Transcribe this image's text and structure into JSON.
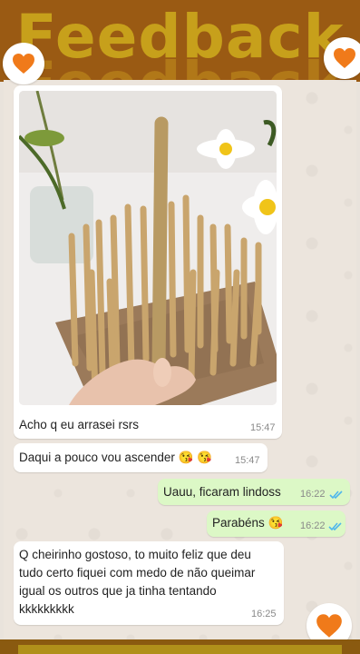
{
  "banner": {
    "title": "Feedback"
  },
  "messages": [
    {
      "text": "Acho q eu arrasei rsrs",
      "time": "15:47"
    },
    {
      "text": "Daqui a pouco vou ascender 😘 😘",
      "time": "15:47"
    },
    {
      "text": "Uauu, ficaram lindoss",
      "time": "16:22"
    },
    {
      "text": "Parabéns 😘",
      "time": "16:22"
    },
    {
      "text": "Q cheirinho gostoso, to muito feliz que deu tudo certo fiquei com medo de não queimar igual os outros que ja tinha tentando kkkkkkkkk",
      "time": "16:25"
    }
  ],
  "colors": {
    "accent": "#f07a1a",
    "incoming": "#ffffff",
    "outgoing": "#dcf8c6",
    "read_ticks": "#4fb6ec",
    "banner": "#9a5a13"
  },
  "icons": [
    "heart-icon",
    "double-check-icon"
  ]
}
